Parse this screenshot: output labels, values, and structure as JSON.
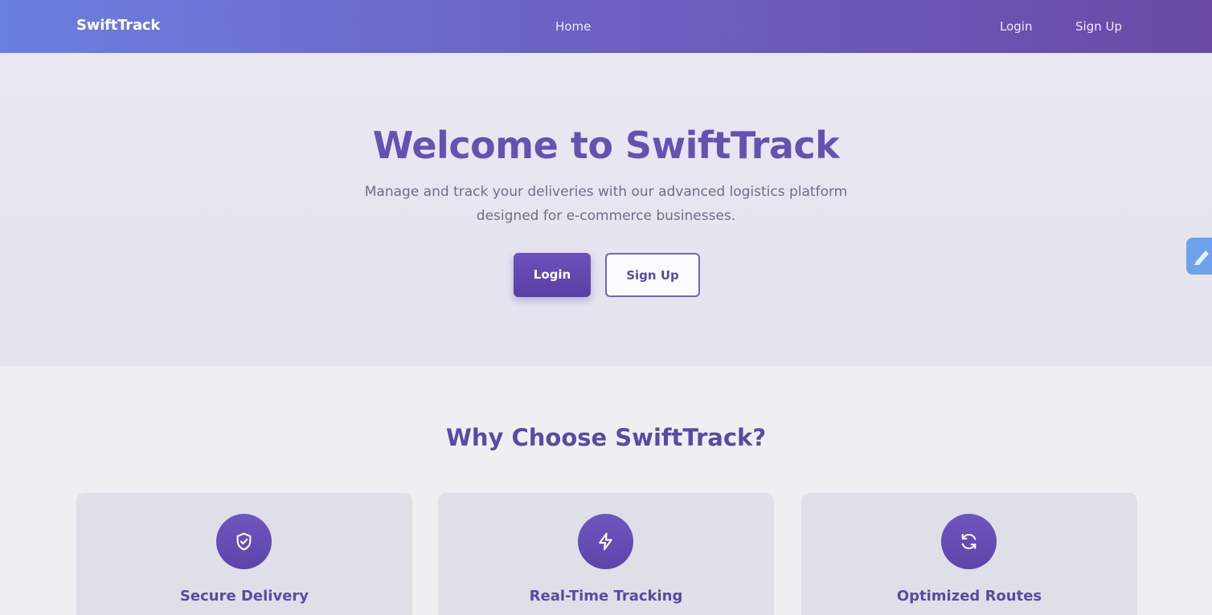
{
  "nav": {
    "brand": "SwiftTrack",
    "home": "Home",
    "login": "Login",
    "signup": "Sign Up"
  },
  "hero": {
    "title": "Welcome to SwiftTrack",
    "subtitle_line1": "Manage and track your deliveries with our advanced logistics platform",
    "subtitle_line2": "designed for e-commerce businesses.",
    "login_button": "Login",
    "signup_button": "Sign Up"
  },
  "features": {
    "title": "Why Choose SwiftTrack?",
    "cards": [
      {
        "title": "Secure Delivery",
        "icon": "shield-check-icon"
      },
      {
        "title": "Real-Time Tracking",
        "icon": "lightning-icon"
      },
      {
        "title": "Optimized Routes",
        "icon": "refresh-icon"
      }
    ]
  },
  "colors": {
    "primary": "#6552b0",
    "nav_gradient_start": "#6b7fe0",
    "nav_gradient_end": "#6a4aa6"
  }
}
